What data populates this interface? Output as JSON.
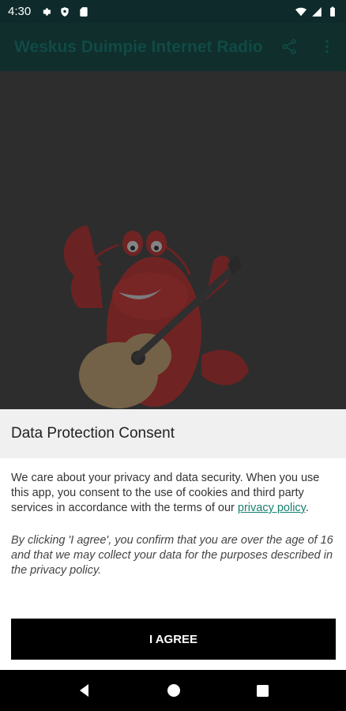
{
  "status_bar": {
    "time": "4:30",
    "left_icons": [
      "settings-gear-icon",
      "shield-icon",
      "sd-card-icon"
    ],
    "right_icons": [
      "wifi-icon",
      "signal-icon",
      "battery-icon"
    ]
  },
  "app_bar": {
    "title": "Weskus Duimpie Internet Radio",
    "actions": [
      "share-icon",
      "more-vert-icon"
    ]
  },
  "consent": {
    "title": "Data Protection Consent",
    "body_prefix": "We care about your privacy and data security. When you use this app, you consent to the use of cookies and third party services in accordance with the terms of our ",
    "link_text": "privacy policy",
    "body_suffix": ".",
    "note": "By clicking 'I agree', you confirm that you are over the age of 16 and that we may collect your data for the purposes described in the privacy policy.",
    "button_label": "I AGREE"
  },
  "nav_bar": {
    "buttons": [
      "back-icon",
      "home-icon",
      "recents-icon"
    ]
  },
  "colors": {
    "status_bar": "#0e2a2a",
    "app_bar": "#0f2e2c",
    "title_text": "#114a45",
    "link": "#17806f",
    "button": "#000000"
  }
}
